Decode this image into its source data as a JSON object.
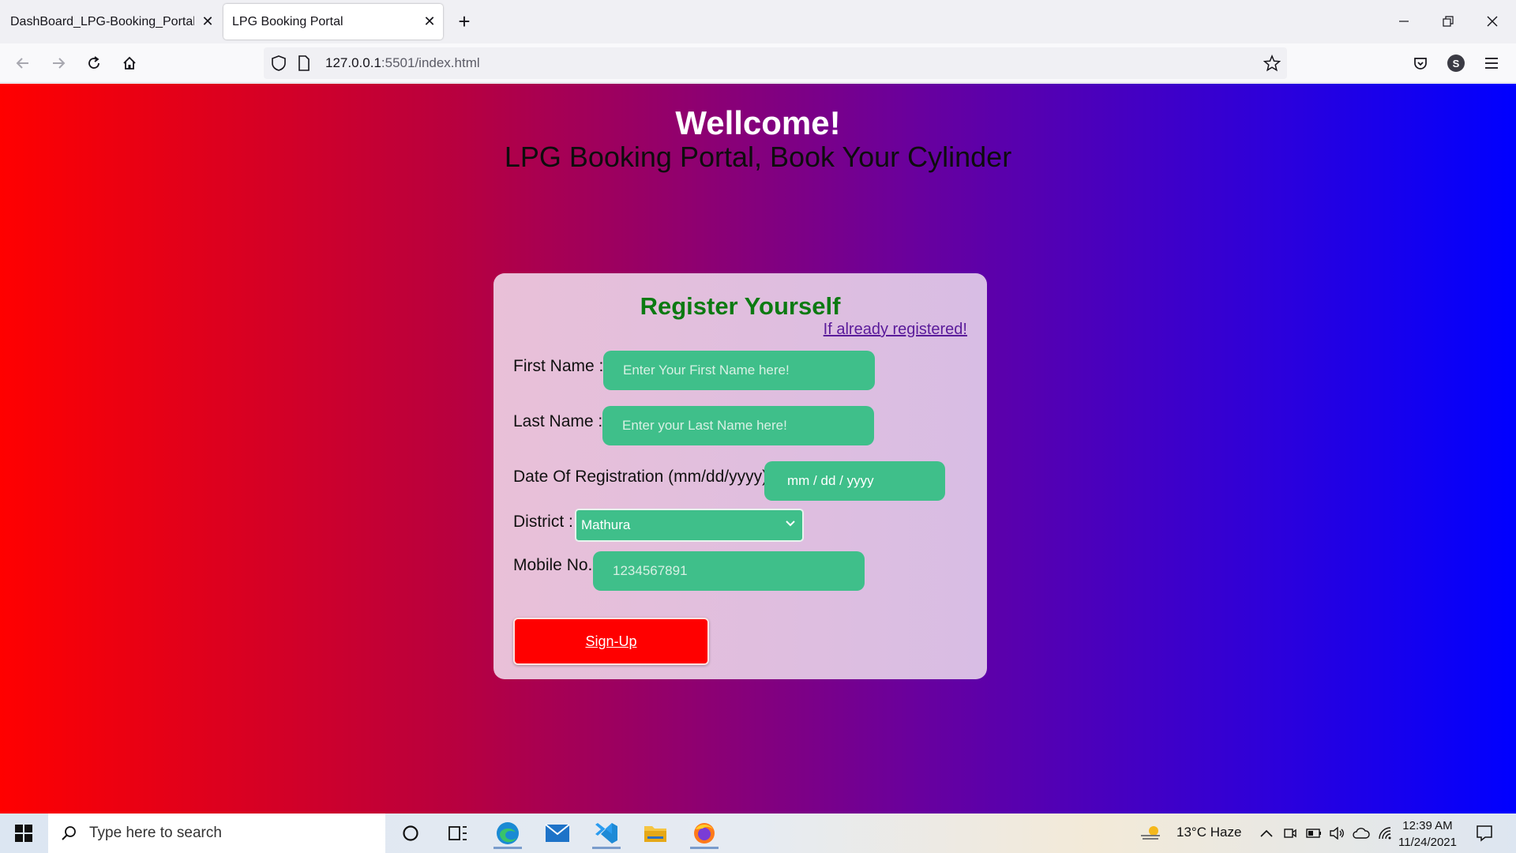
{
  "browser": {
    "tabs": [
      {
        "title": "DashBoard_LPG-Booking_Portal"
      },
      {
        "title": "LPG Booking Portal"
      }
    ],
    "url_host": "127.0.0.1",
    "url_rest": ":5501/index.html",
    "profile_initial": "S"
  },
  "page": {
    "welcome": "Wellcome!",
    "subtitle": "LPG Booking Portal, Book Your Cylinder",
    "form": {
      "title": "Register Yourself",
      "login_link": "If already registered!",
      "first_name_label": "First Name :",
      "first_name_placeholder": "Enter Your First Name here!",
      "last_name_label": "Last Name :",
      "last_name_placeholder": "Enter your Last Name here!",
      "date_label": "Date Of Registration (mm/dd/yyyy):",
      "date_value": "mm / dd / yyyy",
      "district_label": "District :",
      "district_value": "Mathura",
      "mobile_label": "Mobile No.",
      "mobile_placeholder": "1234567891",
      "signup_label": "Sign-Up"
    }
  },
  "taskbar": {
    "search_placeholder": "Type here to search",
    "weather": "13°C  Haze",
    "time": "12:39 AM",
    "date": "11/24/2021"
  },
  "colors": {
    "gradient_left": "#ff0000",
    "gradient_right": "#0000ff",
    "field_bg": "#3fbf8a",
    "title_green": "#0c7a12",
    "signup_red": "#ff0000"
  }
}
